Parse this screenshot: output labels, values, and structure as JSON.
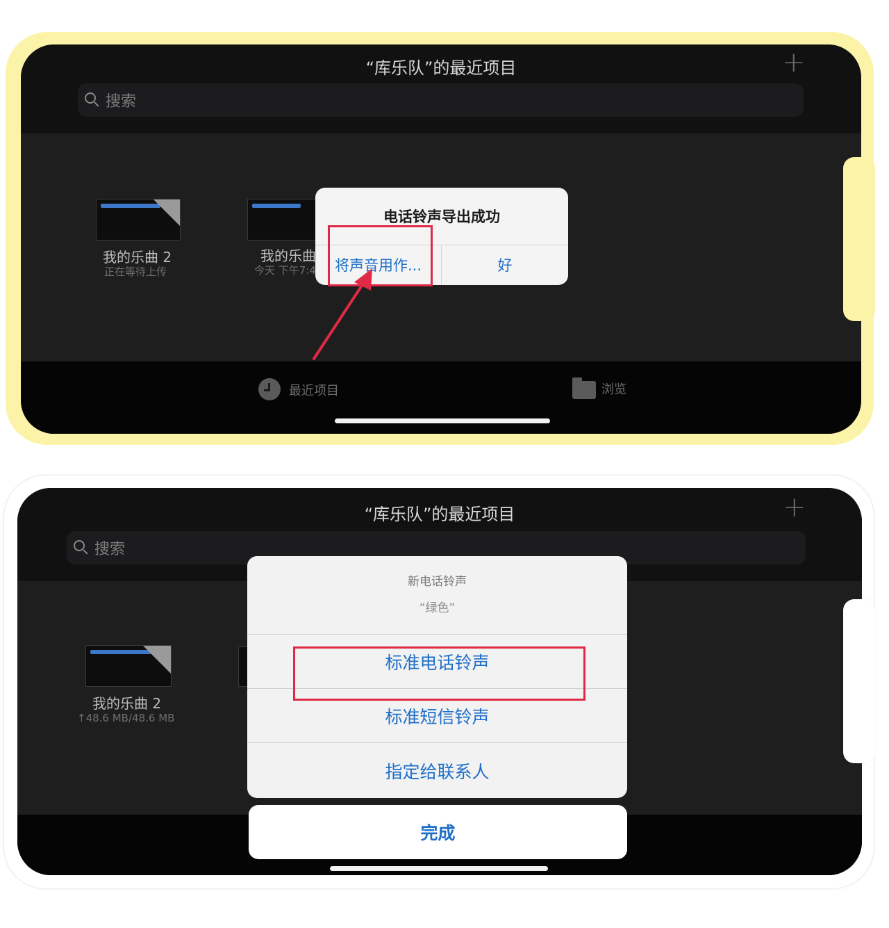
{
  "colors": {
    "case_yellow": "#fbf3a8",
    "case_white": "#ffffff",
    "screen_dark": "#1e1e1e",
    "accent_blue": "#1f6fc8",
    "highlight_red": "#e02a45"
  },
  "top": {
    "nav_title": "“库乐队”的最近项目",
    "add_icon": "plus-icon",
    "search_placeholder": "搜索",
    "doc1": {
      "name": "我的乐曲 2",
      "sub": "正在等待上传"
    },
    "doc2": {
      "name": "我的乐曲",
      "sub": "今天 下午7:4"
    },
    "alert": {
      "title": "电话铃声导出成功",
      "btn_use_as": "将声音用作...",
      "btn_ok": "好"
    },
    "tabs": [
      {
        "label": "最近项目",
        "icon": "clock-icon"
      },
      {
        "label": "浏览",
        "icon": "folder-icon"
      }
    ]
  },
  "bottom": {
    "nav_title": "“库乐队”的最近项目",
    "add_icon": "plus-icon",
    "search_placeholder": "搜索",
    "doc1": {
      "name": "我的乐曲 2",
      "sub": "↑48.6 MB/48.6 MB"
    },
    "sheet": {
      "title": "新电话铃声",
      "subtitle": "“绿色”",
      "options": [
        "标准电话铃声",
        "标准短信铃声",
        "指定给联系人"
      ],
      "done": "完成"
    }
  }
}
